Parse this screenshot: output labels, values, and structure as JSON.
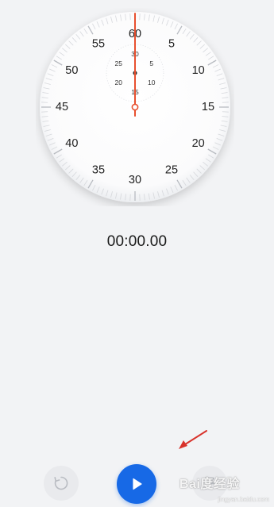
{
  "dial": {
    "main_numbers": [
      "60",
      "5",
      "10",
      "15",
      "20",
      "25",
      "30",
      "35",
      "40",
      "45",
      "50",
      "55"
    ],
    "sub_numbers": [
      "30",
      "5",
      "10",
      "15",
      "20",
      "25"
    ],
    "hand_seconds": 0
  },
  "display": {
    "elapsed_time": "00:00.00"
  },
  "controls": {
    "reset_icon": "reset-icon",
    "start_icon": "play-icon",
    "lap_icon": "lap-icon"
  },
  "colors": {
    "accent": "#1769e6",
    "hand": "#e8502f",
    "background": "#f2f3f5"
  },
  "watermark": {
    "main": "Bai度经验",
    "sub": "jingyan.baidu.com"
  }
}
